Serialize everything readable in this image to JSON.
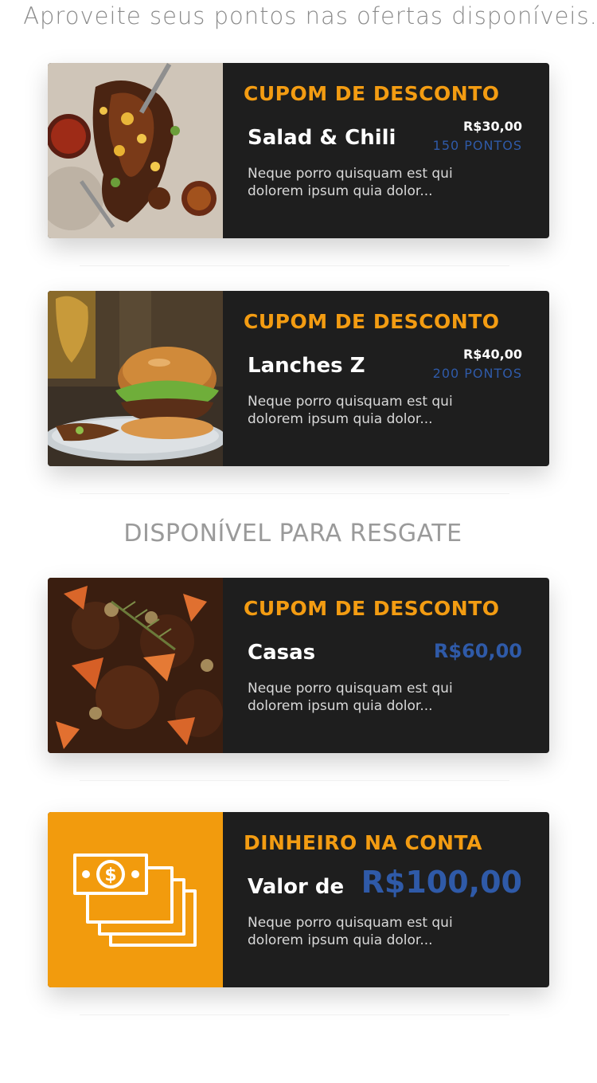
{
  "header": {
    "intro": "Aproveite seus pontos nas ofertas disponíveis."
  },
  "offers": [
    {
      "kind": "CUPOM DE DESCONTO",
      "title": "Salad & Chili",
      "price": "R$30,00",
      "points": "150 PONTOS",
      "description": "Neque porro quisquam est qui dolorem ipsum quia dolor...",
      "image": "food-photo-salad-chili"
    },
    {
      "kind": "CUPOM DE DESCONTO",
      "title": "Lanches Z",
      "price": "R$40,00",
      "points": "200 PONTOS",
      "description": "Neque porro quisquam est qui dolorem ipsum quia dolor...",
      "image": "food-photo-burger"
    }
  ],
  "redeem_section": {
    "title": "DISPONÍVEL PARA RESGATE",
    "items": [
      {
        "kind": "CUPOM DE DESCONTO",
        "title": "Casas",
        "price": "R$60,00",
        "description": "Neque porro quisquam est qui dolorem ipsum quia dolor...",
        "image": "food-photo-stew"
      },
      {
        "kind": "DINHEIRO NA CONTA",
        "title": "Valor de",
        "price": "R$100,00",
        "description": "Neque porro quisquam est qui dolorem ipsum quia dolor...",
        "icon": "cash-stack-icon"
      }
    ]
  },
  "colors": {
    "accent": "#f39c12",
    "points_blue": "#2f5aa8",
    "card_bg": "#1e1e1e",
    "money_bg": "#f29b0d"
  }
}
